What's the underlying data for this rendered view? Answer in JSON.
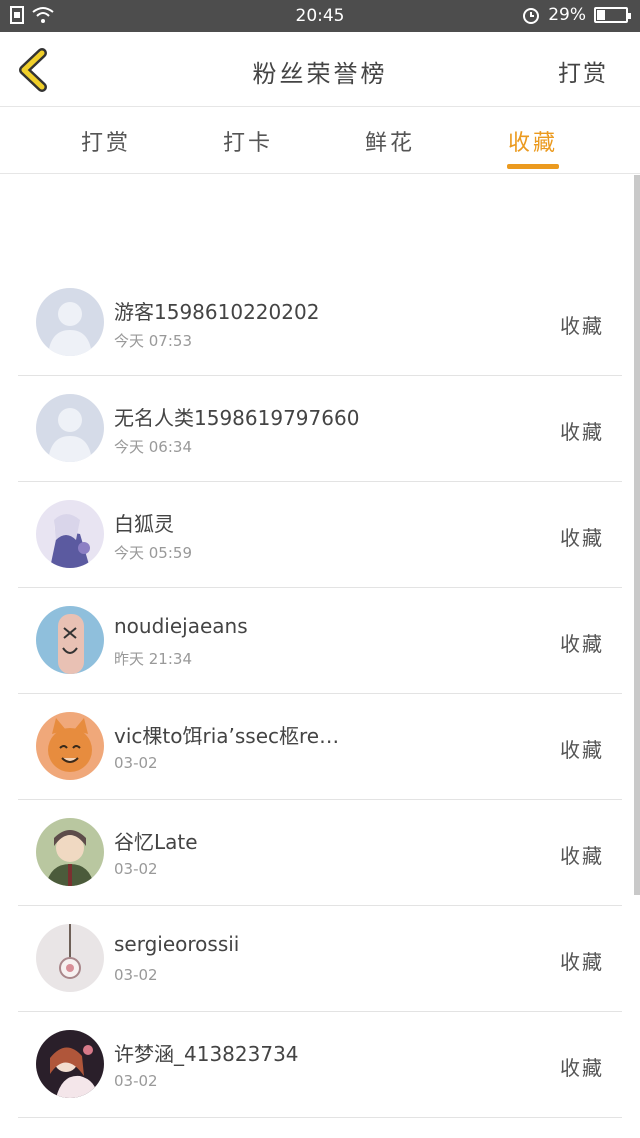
{
  "status": {
    "time": "20:45",
    "battery": "29%",
    "battery_level": 0.29
  },
  "nav": {
    "title": "粉丝荣誉榜",
    "right": "打赏"
  },
  "tabs": [
    {
      "label": "打赏",
      "active": false
    },
    {
      "label": "打卡",
      "active": false
    },
    {
      "label": "鲜花",
      "active": false
    },
    {
      "label": "收藏",
      "active": true
    }
  ],
  "accent": "#eb9a1f",
  "list": [
    {
      "name": "游客1598610220202",
      "time": "今天 07:53",
      "action": "收藏",
      "avatar": "default-avatar"
    },
    {
      "name": "无名人类1598619797660",
      "time": "今天 06:34",
      "action": "收藏",
      "avatar": "default-avatar"
    },
    {
      "name": "白狐灵",
      "time": "今天 05:59",
      "action": "收藏",
      "avatar": "anime-avatar"
    },
    {
      "name": "noudiejaeans",
      "time": "昨天 21:34",
      "action": "收藏",
      "avatar": "finger-face-avatar"
    },
    {
      "name": "vic棵to饵ria’ssec柩re…",
      "time": "03-02",
      "action": "收藏",
      "avatar": "cat-avatar"
    },
    {
      "name": "谷忆Late",
      "time": "03-02",
      "action": "收藏",
      "avatar": "anime-boy-avatar"
    },
    {
      "name": "sergieorossii",
      "time": "03-02",
      "action": "收藏",
      "avatar": "pendant-avatar"
    },
    {
      "name": "许梦涵_413823734",
      "time": "03-02",
      "action": "收藏",
      "avatar": "anime-girl-avatar"
    }
  ]
}
